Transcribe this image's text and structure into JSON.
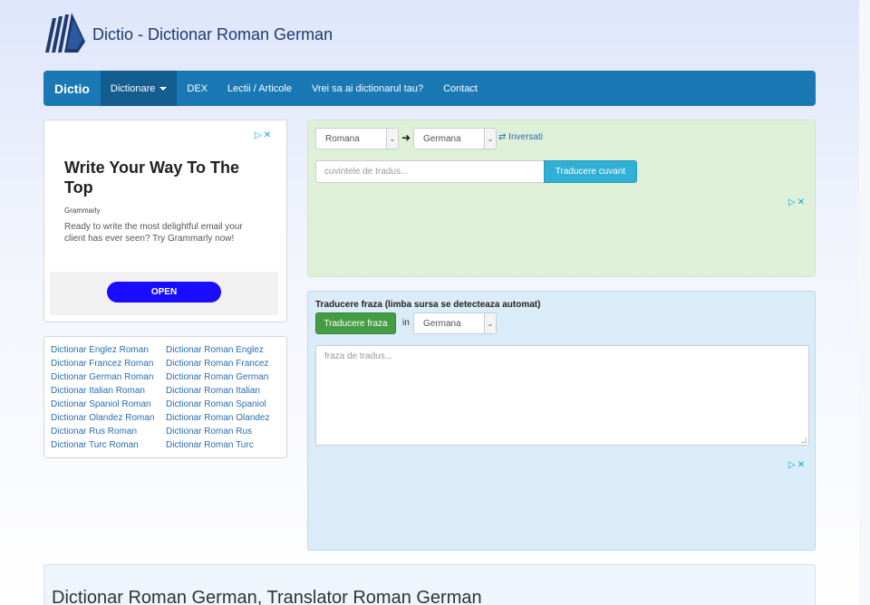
{
  "header": {
    "logo_icon": "books-logo-icon",
    "site_title": "Dictio - Dictionar Roman German"
  },
  "navbar": {
    "brand": "Dictio",
    "items": [
      {
        "label": "Dictionare",
        "active": true,
        "dropdown": true
      },
      {
        "label": "DEX"
      },
      {
        "label": "Lectii / Articole"
      },
      {
        "label": "Vrei sa ai dictionarul tau?"
      },
      {
        "label": "Contact"
      }
    ]
  },
  "left_ad": {
    "info_icon": "ad-choices-icon",
    "title": "Write Your Way To The Top",
    "brand": "Grammarly",
    "description": "Ready to write the most delightful email your client has ever seen? Try Grammarly now!",
    "cta": "OPEN"
  },
  "dictionaries": {
    "rows": [
      [
        "Dictionar Englez Roman",
        "Dictionar Roman Englez"
      ],
      [
        "Dictionar Francez Roman",
        "Dictionar Roman Francez"
      ],
      [
        "Dictionar German Roman",
        "Dictionar Roman German"
      ],
      [
        "Dictionar Italian Roman",
        "Dictionar Roman Italian"
      ],
      [
        "Dictionar Spaniol Roman",
        "Dictionar Roman Spaniol"
      ],
      [
        "Dictionar Olandez Roman",
        "Dictionar Roman Olandez"
      ],
      [
        "Dictionar Rus Roman",
        "Dictionar Roman Rus"
      ],
      [
        "Dictionar Turc Roman",
        "Dictionar Roman Turc"
      ]
    ]
  },
  "word_translator": {
    "source_language": "Romana",
    "target_language": "Germana",
    "swap_label": "Inversati",
    "input_placeholder": "cuvintele de tradus...",
    "button_label": "Traducere cuvant"
  },
  "phrase_translator": {
    "title": "Traducere fraza (limba sursa se detecteaza automat)",
    "button_label": "Traducere fraza",
    "in_label": "in",
    "target_language": "Germana",
    "textarea_placeholder": "fraza de tradus..."
  },
  "bottom": {
    "heading": "Dictionar Roman German, Translator Roman German"
  },
  "colors": {
    "navbar": "#1a78b5",
    "navbar_active": "#135d8f",
    "word_panel_bg": "#dff0d8",
    "phrase_panel_bg": "#d9ecf7",
    "info_button": "#31b0d5",
    "success_button": "#449d44",
    "ad_cta": "#1a0dff",
    "link": "#2a6db0"
  }
}
